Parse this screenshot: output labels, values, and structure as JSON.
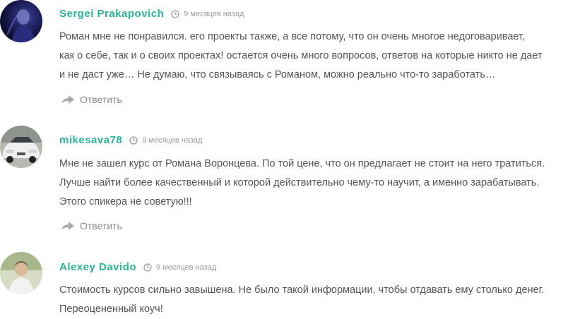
{
  "comments": [
    {
      "author": "Sergei Prakapovich",
      "date": "9 месяцев назад",
      "lines": [
        "Роман мне не понравился. его проекты также, а все потому, что он очень многое недоговаривает,",
        "как о себе, так и о своих проектах! остается очень много вопросов, ответов на которые никто не дает",
        "и не даст уже… Не думаю, что связываясь с Романом, можно реально что-то заработать…"
      ],
      "reply_label": "Ответить"
    },
    {
      "author": "mikesava78",
      "date": "9 месяцев назад",
      "lines": [
        "Мне не зашел курс от Романа Воронцева. По той цене, что он предлагает не стоит на него тратиться.",
        "Лучше найти более качественный и которой действительно чему-то научит, а именно зарабатывать.",
        "Этого спикера не советую!!!"
      ],
      "reply_label": "Ответить"
    },
    {
      "author": "Alexey Davido",
      "date": "9 месяцев назад",
      "lines": [
        "Стоимость курсов сильно завышена. Не было такой информации, чтобы отдавать ему столько денег.",
        "Переоцененный коуч!"
      ]
    }
  ],
  "colors": {
    "author": "#2bb39a",
    "text": "#555555",
    "muted": "#9a9a9a"
  },
  "icons": {
    "date": "clock-icon",
    "reply": "reply-arrow-icon"
  }
}
